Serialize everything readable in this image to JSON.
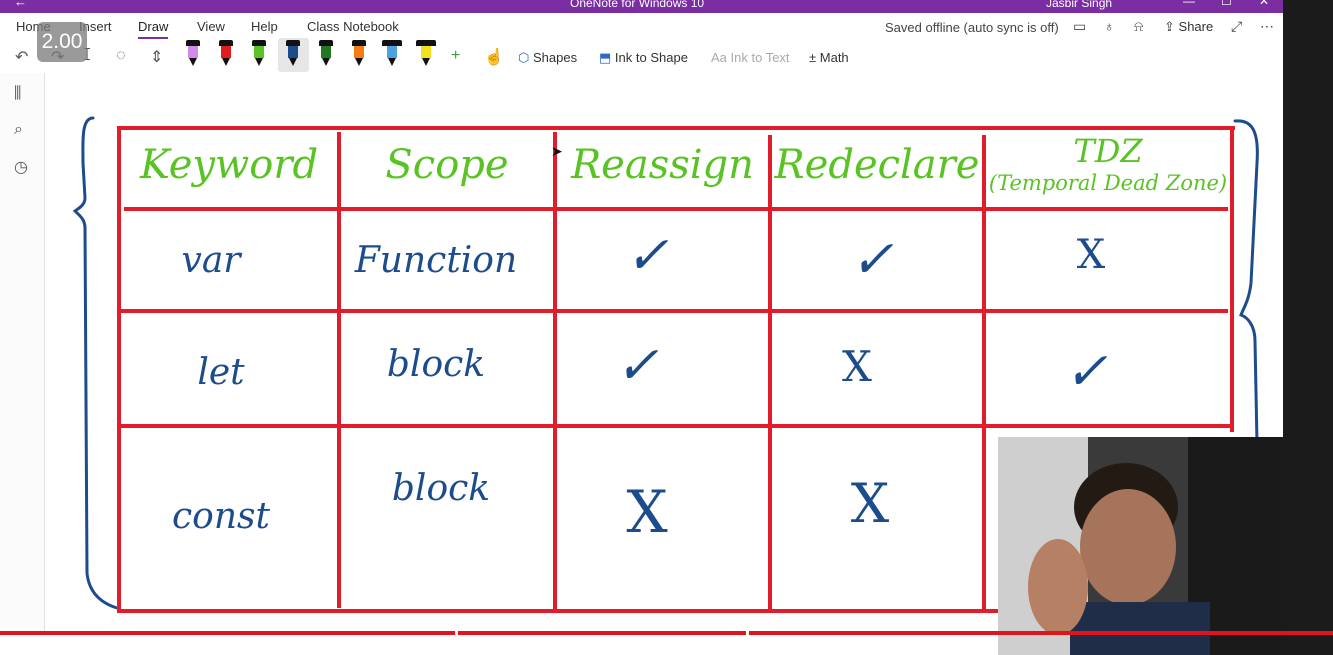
{
  "window": {
    "title": "OneNote for Windows 10",
    "user": "Jasbir Singh"
  },
  "menu": {
    "items": [
      "Home",
      "Insert",
      "Draw",
      "View",
      "Help",
      "Class Notebook"
    ],
    "active": "Draw",
    "status": "Saved offline (auto sync is off)",
    "share_label": "Share"
  },
  "toolbar": {
    "shapes_label": "Shapes",
    "ink_to_shape_label": "Ink to Shape",
    "ink_to_text_label": "Ink to Text",
    "math_label": "Math",
    "pen_colors": [
      "#d48ae8",
      "#e01c1c",
      "#58c322",
      "#1c4c8c",
      "#1f7a1f",
      "#f57d14",
      "#4aa3df",
      "#f3e21b"
    ]
  },
  "player": {
    "speed": "2.00",
    "progress_percent": 100
  },
  "table": {
    "headers": [
      "Keyword",
      "Scope",
      "Reassign",
      "Redeclare",
      "TDZ"
    ],
    "tdz_note": "(Temporal Dead Zone)",
    "rows": [
      [
        "var",
        "Function",
        "✓",
        "✓",
        "X"
      ],
      [
        "let",
        "block",
        "✓",
        "X",
        "✓"
      ],
      [
        "const",
        "block",
        "X",
        "X",
        ""
      ]
    ]
  },
  "colors": {
    "accent": "#7a2ea1",
    "grid": "#e11d2b",
    "header_ink": "#58c322",
    "body_ink": "#1c4c8c"
  }
}
